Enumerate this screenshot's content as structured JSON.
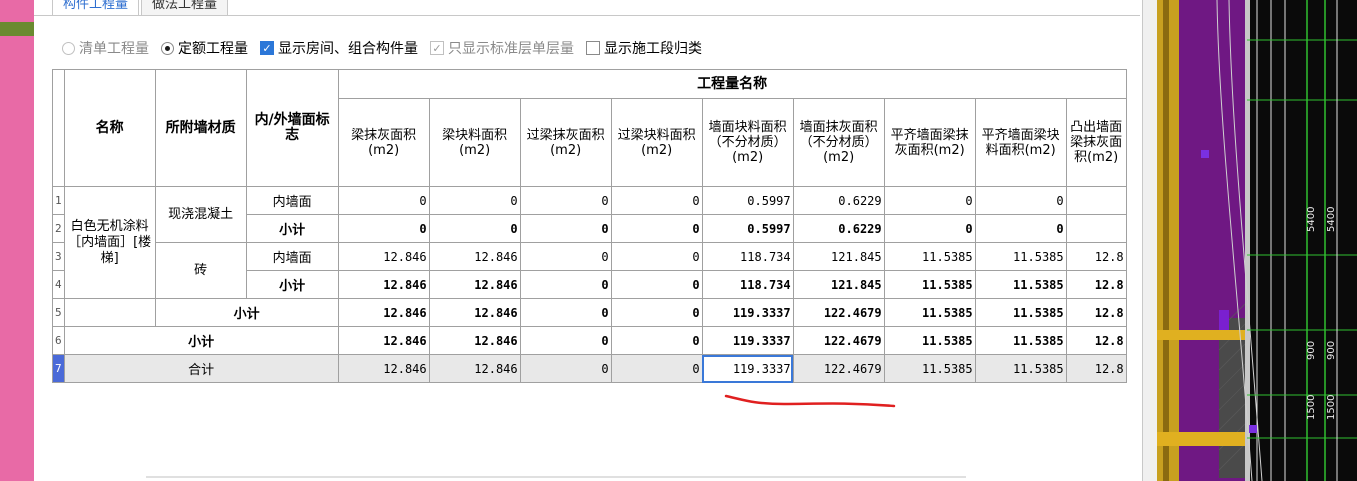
{
  "tabs": [
    {
      "label": "构件工程量",
      "active": true
    },
    {
      "label": "做法工程量",
      "active": false
    }
  ],
  "options": {
    "radio_bill": "清单工程量",
    "radio_quota": "定额工程量",
    "check_rooms": "显示房间、组合构件量",
    "check_standard": "只显示标准层单层量",
    "check_section": "显示施工段归类"
  },
  "table": {
    "group_header": "工程量名称",
    "fixed_headers": [
      "名称",
      "所附墙材质",
      "内/外墙面标志"
    ],
    "columns": [
      "梁抹灰面积(m2)",
      "梁块料面积(m2)",
      "过梁抹灰面积(m2)",
      "过梁块料面积(m2)",
      "墙面块料面积（不分材质）(m2)",
      "墙面抹灰面积（不分材质）(m2)",
      "平齐墙面梁抹灰面积(m2)",
      "平齐墙面梁块料面积(m2)",
      "凸出墙面梁抹灰面积(m2)"
    ],
    "row_numbers": [
      "1",
      "2",
      "3",
      "4",
      "5",
      "6",
      "7"
    ],
    "name": "白色无机涂料［内墙面］[楼梯]",
    "material_1": "现浇混凝土",
    "material_2": "砖",
    "inner": "内墙面",
    "subtotal": "小计",
    "total": "合计",
    "rows": [
      [
        "0",
        "0",
        "0",
        "0",
        "0.5997",
        "0.6229",
        "0",
        "0",
        ""
      ],
      [
        "0",
        "0",
        "0",
        "0",
        "0.5997",
        "0.6229",
        "0",
        "0",
        ""
      ],
      [
        "12.846",
        "12.846",
        "0",
        "0",
        "118.734",
        "121.845",
        "11.5385",
        "11.5385",
        "12.8"
      ],
      [
        "12.846",
        "12.846",
        "0",
        "0",
        "118.734",
        "121.845",
        "11.5385",
        "11.5385",
        "12.8"
      ],
      [
        "12.846",
        "12.846",
        "0",
        "0",
        "119.3337",
        "122.4679",
        "11.5385",
        "11.5385",
        "12.8"
      ],
      [
        "12.846",
        "12.846",
        "0",
        "0",
        "119.3337",
        "122.4679",
        "11.5385",
        "11.5385",
        "12.8"
      ],
      [
        "12.846",
        "12.846",
        "0",
        "0",
        "119.3337",
        "122.4679",
        "11.5385",
        "11.5385",
        "12.8"
      ]
    ]
  },
  "cad": {
    "dims": [
      "5400",
      "5400",
      "900",
      "900",
      "1500",
      "1500"
    ]
  },
  "colors": {
    "accent": "#2b77d8",
    "annotation": "#e02020",
    "cad_bg": "#0a0a0a",
    "cad_wall": "#c8a020",
    "cad_magenta": "#8a1aa0"
  }
}
